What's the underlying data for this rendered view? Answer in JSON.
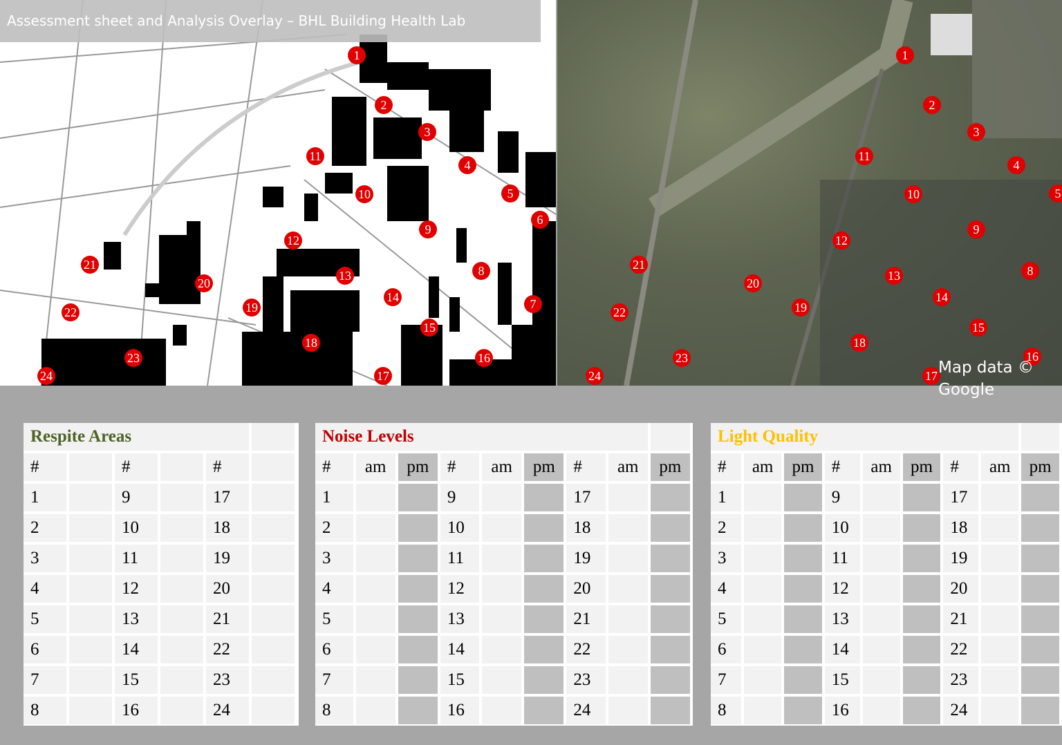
{
  "header": {
    "title": "Assessment sheet and Analysis Overlay – BHL Building Health Lab"
  },
  "map": {
    "credit": "Map data © Google",
    "markers_left": [
      "1",
      "2",
      "3",
      "4",
      "5",
      "6",
      "7",
      "8",
      "9",
      "10",
      "11",
      "12",
      "13",
      "14",
      "15",
      "16",
      "17",
      "18",
      "19",
      "20",
      "21",
      "22",
      "23",
      "24"
    ],
    "markers_right": [
      "1",
      "2",
      "3",
      "4",
      "5",
      "8",
      "9",
      "10",
      "11",
      "12",
      "13",
      "14",
      "15",
      "16",
      "17",
      "18",
      "19",
      "20",
      "21",
      "22",
      "23",
      "24"
    ],
    "marker_color": "#e00000"
  },
  "tables": [
    {
      "title": "Respite Areas",
      "color": "#4f6228",
      "headers": [
        "#",
        "",
        "#",
        "",
        "#",
        ""
      ],
      "rows": [
        [
          "1",
          "9",
          "17"
        ],
        [
          "2",
          "10",
          "18"
        ],
        [
          "3",
          "11",
          "19"
        ],
        [
          "4",
          "12",
          "20"
        ],
        [
          "5",
          "13",
          "21"
        ],
        [
          "6",
          "14",
          "22"
        ],
        [
          "7",
          "15",
          "23"
        ],
        [
          "8",
          "16",
          "24"
        ]
      ]
    },
    {
      "title": "Noise Levels",
      "color": "#c00000",
      "headers": [
        "#",
        "am",
        "pm",
        "#",
        "am",
        "pm",
        "#",
        "am",
        "pm"
      ],
      "rows": [
        [
          "1",
          "9",
          "17"
        ],
        [
          "2",
          "10",
          "18"
        ],
        [
          "3",
          "11",
          "19"
        ],
        [
          "4",
          "12",
          "20"
        ],
        [
          "5",
          "13",
          "21"
        ],
        [
          "6",
          "14",
          "22"
        ],
        [
          "7",
          "15",
          "23"
        ],
        [
          "8",
          "16",
          "24"
        ]
      ]
    },
    {
      "title": "Light Quality",
      "color": "#ffc000",
      "headers": [
        "#",
        "am",
        "pm",
        "#",
        "am",
        "pm",
        "#",
        "am",
        "pm"
      ],
      "rows": [
        [
          "1",
          "9",
          "17"
        ],
        [
          "2",
          "10",
          "18"
        ],
        [
          "3",
          "11",
          "19"
        ],
        [
          "4",
          "12",
          "20"
        ],
        [
          "5",
          "13",
          "21"
        ],
        [
          "6",
          "14",
          "22"
        ],
        [
          "7",
          "15",
          "23"
        ],
        [
          "8",
          "16",
          "24"
        ]
      ]
    }
  ]
}
